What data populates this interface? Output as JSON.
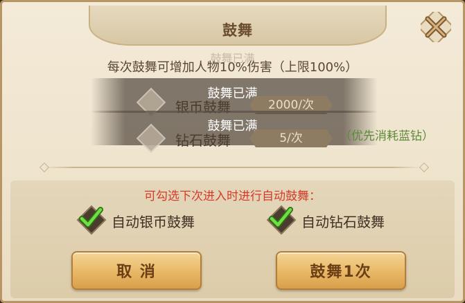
{
  "dialog": {
    "title": "鼓舞",
    "ghost_text": "鼓舞已满",
    "info": "每次鼓舞可增加人物10%伤害（上限100%）",
    "rows": [
      {
        "full_text": "鼓舞已满",
        "label": "银币鼓舞",
        "cost": "2000/次"
      },
      {
        "full_text": "鼓舞已满",
        "label": "钻石鼓舞",
        "cost": "5/次"
      }
    ],
    "diamond_hint": "（优先消耗蓝钻）",
    "auto_hint": "可勾选下次进入时进行自动鼓舞：",
    "checkboxes": [
      {
        "label": "自动银币鼓舞",
        "checked": true
      },
      {
        "label": "自动钻石鼓舞",
        "checked": true
      }
    ],
    "cancel_label": "取 消",
    "confirm_label": "鼓舞1次"
  },
  "colors": {
    "red_hint": "#d43b2a",
    "green_hint": "#5c8a3a",
    "check_green": "#5fd23a",
    "button_gold": "#e9ba69"
  }
}
